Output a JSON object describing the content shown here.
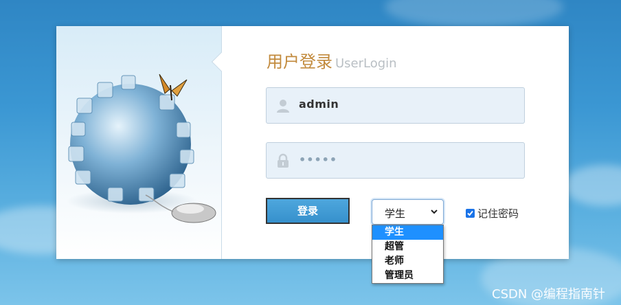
{
  "colors": {
    "title_cn": "#c28a3c",
    "title_en": "#b9bfc4",
    "button": "#3690cc",
    "field_bg": "#e8f1f9",
    "selected_option": "#1e90ff"
  },
  "illustration": {
    "description_icons": [
      "globe-puzzle-icon",
      "butterfly-icon",
      "mouse-icon"
    ]
  },
  "form": {
    "title_cn": "用户登录",
    "title_en": "UserLogin",
    "username": {
      "value": "admin",
      "icon": "user-icon"
    },
    "password": {
      "value": "•••••",
      "icon": "lock-icon"
    },
    "login_button": "登录",
    "role_select": {
      "selected": "学生",
      "options": [
        "学生",
        "超管",
        "老师",
        "管理员"
      ],
      "expanded": true
    },
    "remember": {
      "label": "记住密码",
      "checked": true
    }
  },
  "watermark": "CSDN @编程指南针"
}
